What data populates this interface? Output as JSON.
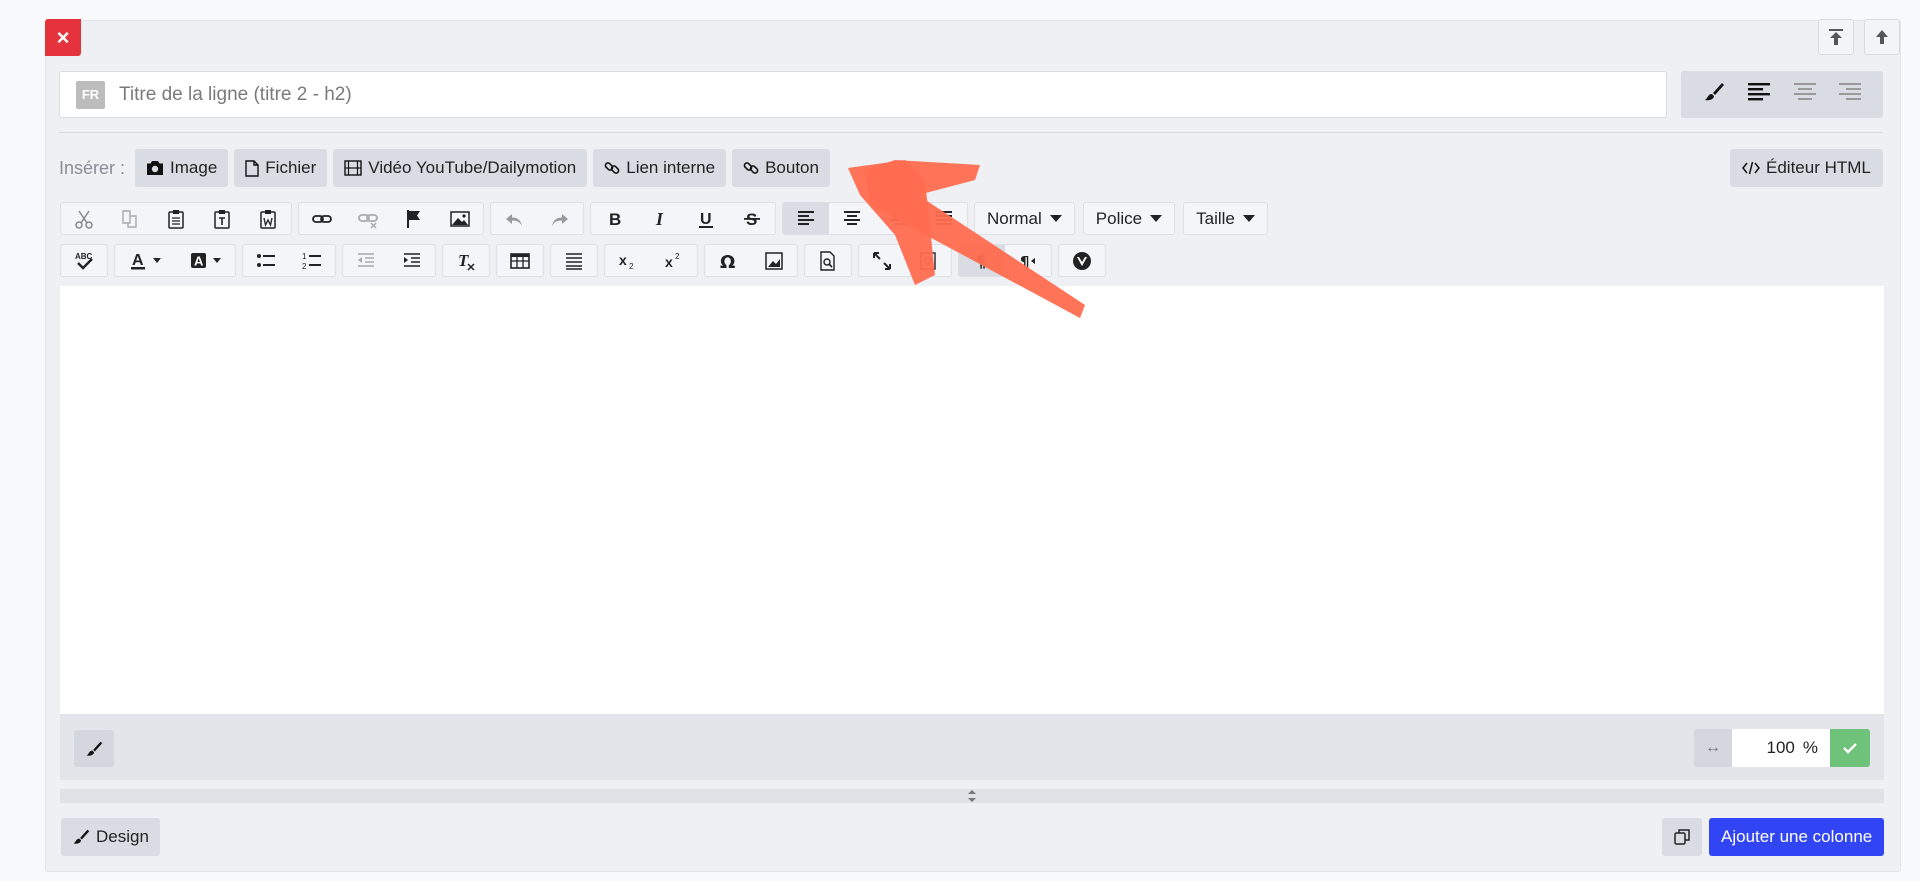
{
  "header": {
    "close_label": "×",
    "lang_badge": "FR",
    "title_placeholder": "Titre de la ligne (titre 2 - h2)"
  },
  "insert": {
    "label": "Insérer :",
    "buttons": [
      {
        "label": "Image",
        "icon": "camera-icon"
      },
      {
        "label": "Fichier",
        "icon": "file-icon"
      },
      {
        "label": "Vidéo YouTube/Dailymotion",
        "icon": "film-icon"
      },
      {
        "label": "Lien interne",
        "icon": "link-icon"
      },
      {
        "label": "Bouton",
        "icon": "link-icon"
      }
    ],
    "html_editor_label": "Éditeur HTML"
  },
  "toolbar": {
    "format_select": "Normal",
    "font_select": "Police",
    "size_select": "Taille"
  },
  "footer": {
    "width_value": "100",
    "width_unit": "%",
    "design_label": "Design",
    "add_column_label": "Ajouter une colonne"
  },
  "colors": {
    "accent": "#3245f5",
    "danger": "#e5333d",
    "success": "#6fc27a",
    "annotation": "#ff6b4f"
  }
}
